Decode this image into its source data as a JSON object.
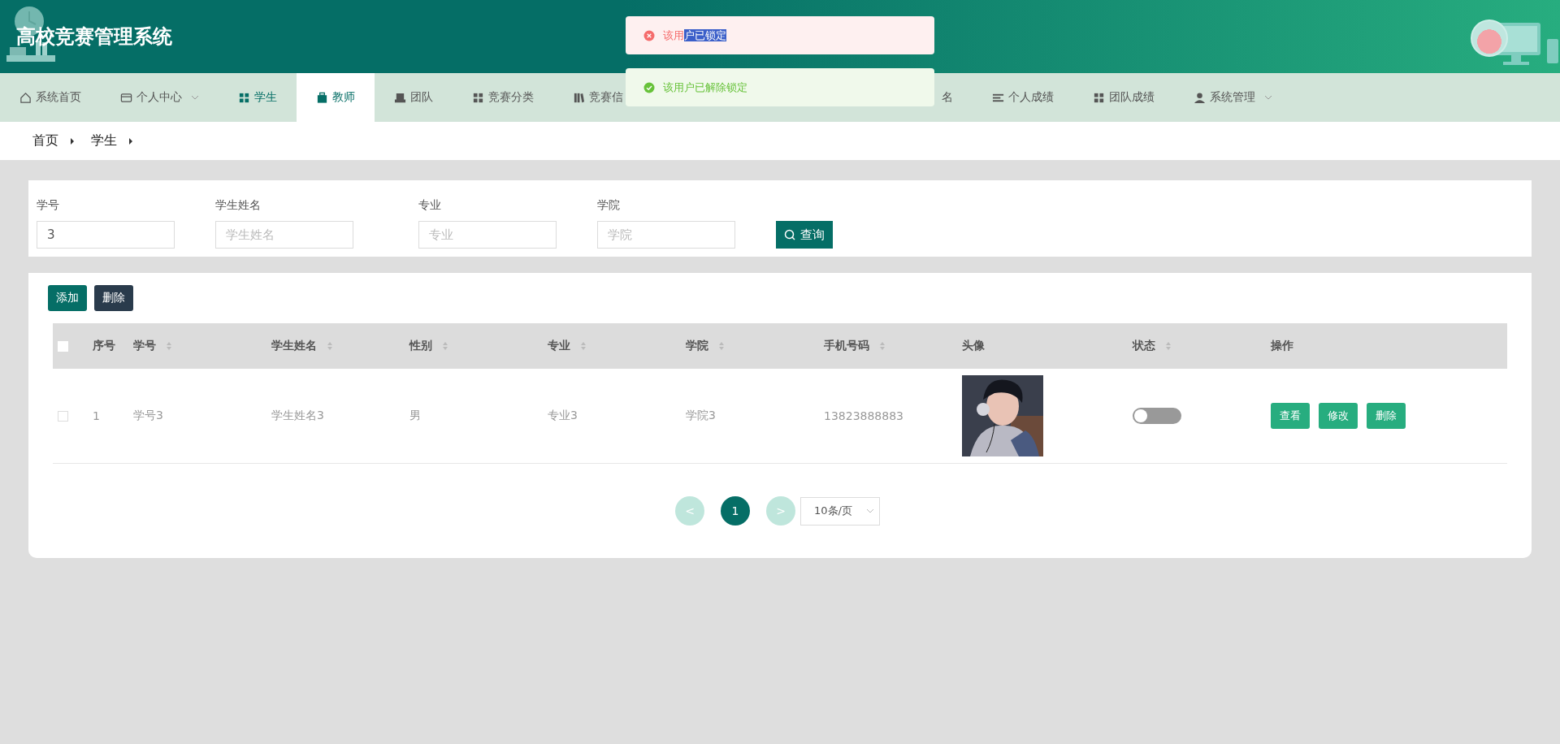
{
  "header": {
    "title": "高校竞赛管理系统"
  },
  "toasts": [
    {
      "kind": "error",
      "message": "该用",
      "highlighted_part": "户已锁定"
    },
    {
      "kind": "success",
      "message": "该用户已解除锁定"
    }
  ],
  "nav": [
    {
      "label": "系统首页",
      "selected": false,
      "current": false,
      "dropdown": false
    },
    {
      "label": "个人中心",
      "selected": false,
      "current": false,
      "dropdown": true
    },
    {
      "label": "学生",
      "selected": false,
      "current": true,
      "dropdown": false
    },
    {
      "label": "教师",
      "selected": true,
      "current": false,
      "dropdown": false
    },
    {
      "label": "团队",
      "selected": false,
      "current": false,
      "dropdown": false
    },
    {
      "label": "竞赛分类",
      "selected": false,
      "current": false,
      "dropdown": false
    },
    {
      "label": "竞赛信",
      "selected": false,
      "current": false,
      "dropdown": false
    },
    {
      "label": "名",
      "selected": false,
      "current": false,
      "dropdown": false
    },
    {
      "label": "个人成绩",
      "selected": false,
      "current": false,
      "dropdown": false
    },
    {
      "label": "团队成绩",
      "selected": false,
      "current": false,
      "dropdown": false
    },
    {
      "label": "系统管理",
      "selected": false,
      "current": false,
      "dropdown": true
    }
  ],
  "breadcrumb": [
    "首页",
    "学生"
  ],
  "search": {
    "fields": [
      {
        "label": "学号",
        "value": "3"
      },
      {
        "label": "学生姓名",
        "placeholder": "学生姓名"
      },
      {
        "label": "专业",
        "placeholder": "专业"
      },
      {
        "label": "学院",
        "placeholder": "学院"
      }
    ],
    "button": "查询"
  },
  "actions": [
    {
      "label": "添加",
      "kind": "primary"
    },
    {
      "label": "删除",
      "kind": "dark"
    }
  ],
  "table": {
    "select_all_checked": false,
    "columns": [
      {
        "label": "序号",
        "sortable": false
      },
      {
        "label": "学号",
        "sortable": true
      },
      {
        "label": "学生姓名",
        "sortable": true
      },
      {
        "label": "性别",
        "sortable": true
      },
      {
        "label": "专业",
        "sortable": true
      },
      {
        "label": "学院",
        "sortable": true
      },
      {
        "label": "手机号码",
        "sortable": true
      },
      {
        "label": "头像",
        "sortable": false
      },
      {
        "label": "状态",
        "sortable": true
      },
      {
        "label": "操作",
        "sortable": false
      }
    ],
    "rows": [
      {
        "checked": false,
        "index": "1",
        "student_no": "学号3",
        "name": "学生姓名3",
        "gender": "男",
        "major": "专业3",
        "college": "学院3",
        "phone": "13823888883",
        "avatar": {
          "kind": "picture"
        },
        "on": false,
        "buttons": [
          "查看",
          "修改",
          "删除"
        ]
      }
    ]
  },
  "pagination": {
    "prev": "<",
    "pages": [
      {
        "label": "1",
        "selected": true
      }
    ],
    "next": ">",
    "page_size": "10条/页"
  }
}
